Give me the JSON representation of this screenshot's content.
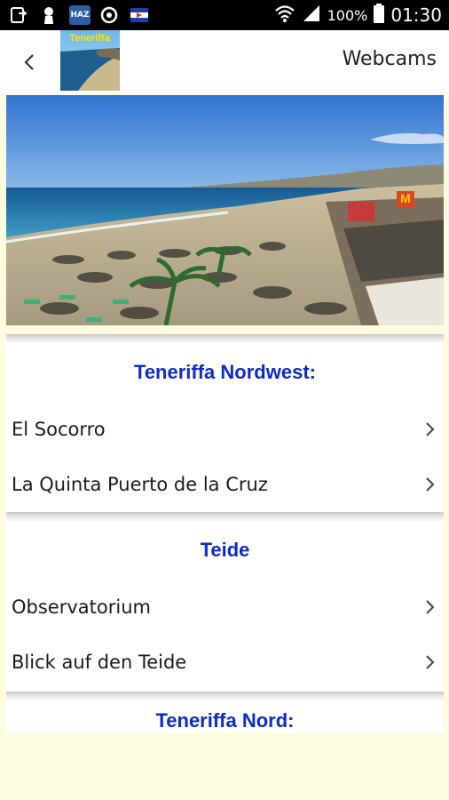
{
  "status_bar": {
    "battery_percent": "100%",
    "time": "01:30",
    "icons": [
      "download-icon",
      "keyhole-icon",
      "news-app-icon",
      "sync-icon",
      "flag-icon",
      "wifi-icon",
      "signal-icon",
      "battery-icon"
    ],
    "news_icon_label": "HAZ"
  },
  "app_bar": {
    "back_icon": "chevron-left-icon",
    "logo_text": "Teneriffa",
    "title": "Webcams"
  },
  "sections": [
    {
      "heading": "Teneriffa Nordwest:",
      "items": [
        "El Socorro",
        "La Quinta Puerto de la Cruz"
      ]
    },
    {
      "heading": "Teide",
      "items": [
        "Observatorium",
        "Blick auf den Teide"
      ]
    },
    {
      "heading": "Teneriffa Nord:",
      "items": []
    }
  ],
  "colors": {
    "heading": "#0e2bc6",
    "background": "#fdfbe0",
    "status_bar": "#000000"
  }
}
